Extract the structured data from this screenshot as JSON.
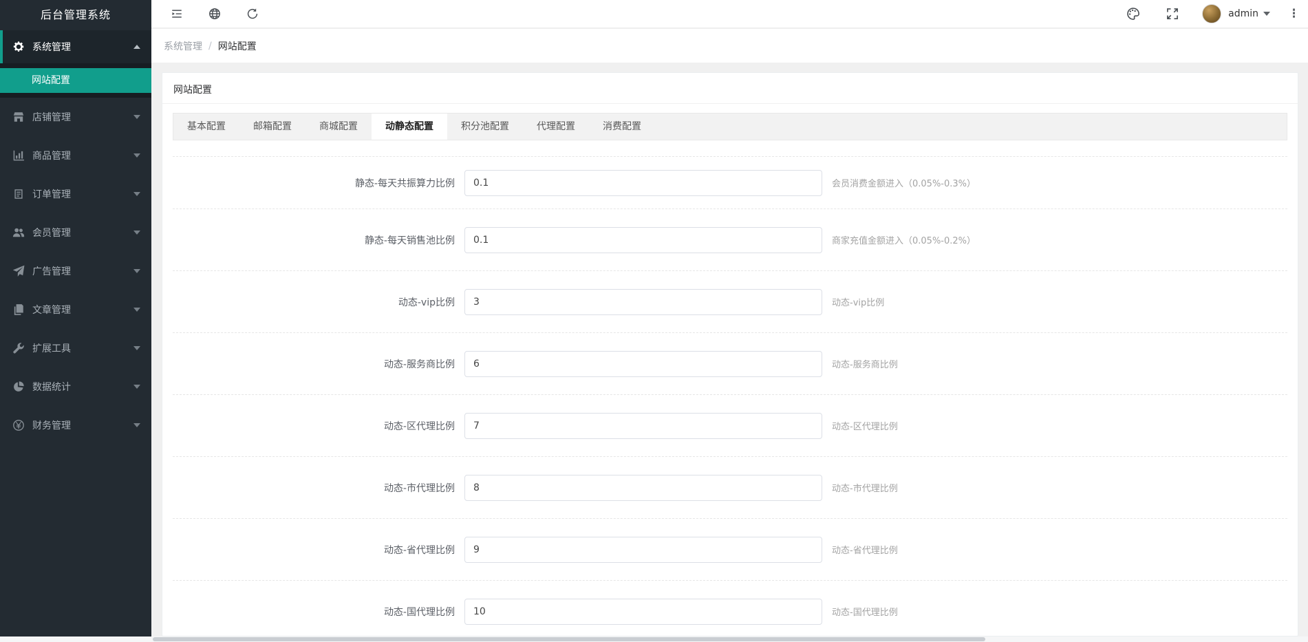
{
  "app": {
    "title": "后台管理系统"
  },
  "colors": {
    "accent_teal": "#119e8c",
    "sidebar_bg": "#232b32",
    "sidebar_submenu_bg": "#171d22",
    "content_bg": "#f0f0f0",
    "tabbar_bg": "#f2f2f2"
  },
  "sidebar": {
    "menu": [
      {
        "label": "系统管理",
        "icon": "gear-icon",
        "expanded": true,
        "children": [
          {
            "label": "网站配置",
            "active": true
          }
        ]
      },
      {
        "label": "店铺管理",
        "icon": "shop-icon"
      },
      {
        "label": "商品管理",
        "icon": "bar-chart-icon"
      },
      {
        "label": "订单管理",
        "icon": "order-list-icon"
      },
      {
        "label": "会员管理",
        "icon": "users-icon"
      },
      {
        "label": "广告管理",
        "icon": "paper-plane-icon"
      },
      {
        "label": "文章管理",
        "icon": "article-copy-icon"
      },
      {
        "label": "扩展工具",
        "icon": "wrench-icon"
      },
      {
        "label": "数据统计",
        "icon": "pie-chart-icon"
      },
      {
        "label": "财务管理",
        "icon": "yen-circle-icon"
      }
    ]
  },
  "topbar": {
    "left_icons": [
      "menu-fold-icon",
      "globe-icon",
      "refresh-icon"
    ],
    "right_icons": [
      "palette-icon",
      "fullscreen-icon"
    ],
    "user": "admin",
    "kebab": "⋮"
  },
  "breadcrumb": {
    "items": [
      "系统管理",
      "网站配置"
    ],
    "separator": "/"
  },
  "page": {
    "card_title": "网站配置",
    "tabs": [
      {
        "label": "基本配置"
      },
      {
        "label": "邮箱配置"
      },
      {
        "label": "商城配置"
      },
      {
        "label": "动静态配置",
        "active": true
      },
      {
        "label": "积分池配置"
      },
      {
        "label": "代理配置"
      },
      {
        "label": "消费配置"
      }
    ],
    "active_tab": "动静态配置"
  },
  "form": {
    "rows": [
      {
        "label": "静态-每天共振算力比例",
        "value": "0.1",
        "help": "会员消费金额进入（0.05%-0.3%）"
      },
      {
        "label": "静态-每天销售池比例",
        "value": "0.1",
        "help": "商家充值金额进入（0.05%-0.2%）"
      },
      {
        "label": "动态-vip比例",
        "value": "3",
        "help": "动态-vip比例"
      },
      {
        "label": "动态-服务商比例",
        "value": "6",
        "help": "动态-服务商比例"
      },
      {
        "label": "动态-区代理比例",
        "value": "7",
        "help": "动态-区代理比例"
      },
      {
        "label": "动态-市代理比例",
        "value": "8",
        "help": "动态-市代理比例"
      },
      {
        "label": "动态-省代理比例",
        "value": "9",
        "help": "动态-省代理比例"
      },
      {
        "label": "动态-国代理比例",
        "value": "10",
        "help": "动态-国代理比例"
      }
    ]
  }
}
